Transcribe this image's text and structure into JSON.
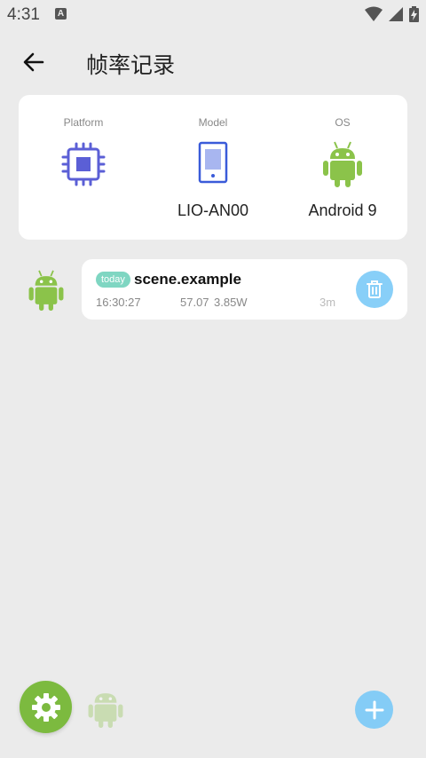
{
  "status_bar": {
    "time": "4:31",
    "notification_letter": "A"
  },
  "header": {
    "title": "帧率记录"
  },
  "device_info": {
    "platform": {
      "label": "Platform",
      "value": "",
      "icon": "chip-icon"
    },
    "model": {
      "label": "Model",
      "value": "LIO-AN00",
      "icon": "phone-icon"
    },
    "os": {
      "label": "OS",
      "value": "Android 9",
      "icon": "android-icon"
    }
  },
  "records": [
    {
      "badge": "today",
      "name": "scene.example",
      "time": "16:30:27",
      "fps": "57.07",
      "power": "3.85W",
      "duration": "3m"
    }
  ],
  "colors": {
    "android_green": "#8bc34a",
    "chip_purple": "#5b5fd6",
    "phone_blue": "#3a5bd9",
    "accent_blue": "#84ccf6",
    "settings_green": "#7cba3f",
    "badge_teal": "#7fd6c2"
  }
}
